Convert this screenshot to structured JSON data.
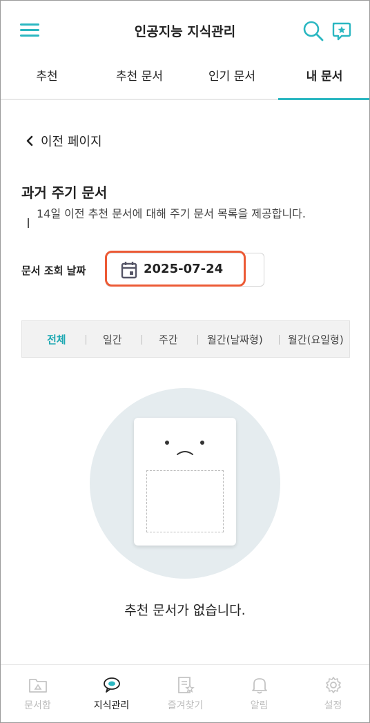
{
  "header": {
    "title": "인공지능 지식관리",
    "menu_icon": "hamburger-menu-icon",
    "search_icon": "search-icon",
    "chat_icon": "chat-star-icon",
    "accent_color": "#2bb7c1"
  },
  "tabs": [
    {
      "label": "추천",
      "active": false
    },
    {
      "label": "추천 문서",
      "active": false
    },
    {
      "label": "인기 문서",
      "active": false
    },
    {
      "label": "내 문서",
      "active": true
    }
  ],
  "back": {
    "label": "이전 페이지",
    "icon": "chevron-left-icon"
  },
  "section": {
    "title": "과거 주기 문서",
    "description": "14일 이전 추천 문서에 대해 주기 문서 목록을 제공합니다."
  },
  "date_query": {
    "label": "문서 조회 날짜",
    "value": "2025-07-24",
    "icon": "calendar-icon",
    "highlight_color": "#ec5a35"
  },
  "filters": [
    {
      "label": "전체",
      "active": true
    },
    {
      "label": "일간",
      "active": false
    },
    {
      "label": "주간",
      "active": false
    },
    {
      "label": "월간(날짜형)",
      "active": false
    },
    {
      "label": "월간(요일형)",
      "active": false
    }
  ],
  "empty_state": {
    "message": "추천 문서가 없습니다.",
    "icon": "sad-document-icon"
  },
  "bottom_nav": [
    {
      "label": "문서함",
      "icon": "folder-icon",
      "active": false
    },
    {
      "label": "지식관리",
      "icon": "ai-chat-icon",
      "active": true
    },
    {
      "label": "즐겨찾기",
      "icon": "bookmark-doc-icon",
      "active": false
    },
    {
      "label": "알림",
      "icon": "bell-icon",
      "active": false
    },
    {
      "label": "설정",
      "icon": "gear-icon",
      "active": false
    }
  ]
}
